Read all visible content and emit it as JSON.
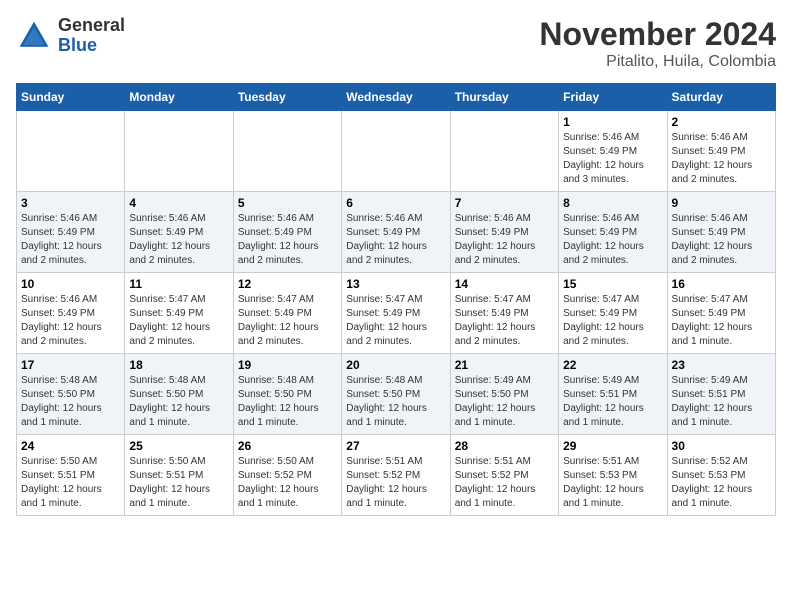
{
  "header": {
    "logo_general": "General",
    "logo_blue": "Blue",
    "month": "November 2024",
    "location": "Pitalito, Huila, Colombia"
  },
  "weekdays": [
    "Sunday",
    "Monday",
    "Tuesday",
    "Wednesday",
    "Thursday",
    "Friday",
    "Saturday"
  ],
  "weeks": [
    [
      {
        "day": "",
        "detail": ""
      },
      {
        "day": "",
        "detail": ""
      },
      {
        "day": "",
        "detail": ""
      },
      {
        "day": "",
        "detail": ""
      },
      {
        "day": "",
        "detail": ""
      },
      {
        "day": "1",
        "detail": "Sunrise: 5:46 AM\nSunset: 5:49 PM\nDaylight: 12 hours and 3 minutes."
      },
      {
        "day": "2",
        "detail": "Sunrise: 5:46 AM\nSunset: 5:49 PM\nDaylight: 12 hours and 2 minutes."
      }
    ],
    [
      {
        "day": "3",
        "detail": "Sunrise: 5:46 AM\nSunset: 5:49 PM\nDaylight: 12 hours and 2 minutes."
      },
      {
        "day": "4",
        "detail": "Sunrise: 5:46 AM\nSunset: 5:49 PM\nDaylight: 12 hours and 2 minutes."
      },
      {
        "day": "5",
        "detail": "Sunrise: 5:46 AM\nSunset: 5:49 PM\nDaylight: 12 hours and 2 minutes."
      },
      {
        "day": "6",
        "detail": "Sunrise: 5:46 AM\nSunset: 5:49 PM\nDaylight: 12 hours and 2 minutes."
      },
      {
        "day": "7",
        "detail": "Sunrise: 5:46 AM\nSunset: 5:49 PM\nDaylight: 12 hours and 2 minutes."
      },
      {
        "day": "8",
        "detail": "Sunrise: 5:46 AM\nSunset: 5:49 PM\nDaylight: 12 hours and 2 minutes."
      },
      {
        "day": "9",
        "detail": "Sunrise: 5:46 AM\nSunset: 5:49 PM\nDaylight: 12 hours and 2 minutes."
      }
    ],
    [
      {
        "day": "10",
        "detail": "Sunrise: 5:46 AM\nSunset: 5:49 PM\nDaylight: 12 hours and 2 minutes."
      },
      {
        "day": "11",
        "detail": "Sunrise: 5:47 AM\nSunset: 5:49 PM\nDaylight: 12 hours and 2 minutes."
      },
      {
        "day": "12",
        "detail": "Sunrise: 5:47 AM\nSunset: 5:49 PM\nDaylight: 12 hours and 2 minutes."
      },
      {
        "day": "13",
        "detail": "Sunrise: 5:47 AM\nSunset: 5:49 PM\nDaylight: 12 hours and 2 minutes."
      },
      {
        "day": "14",
        "detail": "Sunrise: 5:47 AM\nSunset: 5:49 PM\nDaylight: 12 hours and 2 minutes."
      },
      {
        "day": "15",
        "detail": "Sunrise: 5:47 AM\nSunset: 5:49 PM\nDaylight: 12 hours and 2 minutes."
      },
      {
        "day": "16",
        "detail": "Sunrise: 5:47 AM\nSunset: 5:49 PM\nDaylight: 12 hours and 1 minute."
      }
    ],
    [
      {
        "day": "17",
        "detail": "Sunrise: 5:48 AM\nSunset: 5:50 PM\nDaylight: 12 hours and 1 minute."
      },
      {
        "day": "18",
        "detail": "Sunrise: 5:48 AM\nSunset: 5:50 PM\nDaylight: 12 hours and 1 minute."
      },
      {
        "day": "19",
        "detail": "Sunrise: 5:48 AM\nSunset: 5:50 PM\nDaylight: 12 hours and 1 minute."
      },
      {
        "day": "20",
        "detail": "Sunrise: 5:48 AM\nSunset: 5:50 PM\nDaylight: 12 hours and 1 minute."
      },
      {
        "day": "21",
        "detail": "Sunrise: 5:49 AM\nSunset: 5:50 PM\nDaylight: 12 hours and 1 minute."
      },
      {
        "day": "22",
        "detail": "Sunrise: 5:49 AM\nSunset: 5:51 PM\nDaylight: 12 hours and 1 minute."
      },
      {
        "day": "23",
        "detail": "Sunrise: 5:49 AM\nSunset: 5:51 PM\nDaylight: 12 hours and 1 minute."
      }
    ],
    [
      {
        "day": "24",
        "detail": "Sunrise: 5:50 AM\nSunset: 5:51 PM\nDaylight: 12 hours and 1 minute."
      },
      {
        "day": "25",
        "detail": "Sunrise: 5:50 AM\nSunset: 5:51 PM\nDaylight: 12 hours and 1 minute."
      },
      {
        "day": "26",
        "detail": "Sunrise: 5:50 AM\nSunset: 5:52 PM\nDaylight: 12 hours and 1 minute."
      },
      {
        "day": "27",
        "detail": "Sunrise: 5:51 AM\nSunset: 5:52 PM\nDaylight: 12 hours and 1 minute."
      },
      {
        "day": "28",
        "detail": "Sunrise: 5:51 AM\nSunset: 5:52 PM\nDaylight: 12 hours and 1 minute."
      },
      {
        "day": "29",
        "detail": "Sunrise: 5:51 AM\nSunset: 5:53 PM\nDaylight: 12 hours and 1 minute."
      },
      {
        "day": "30",
        "detail": "Sunrise: 5:52 AM\nSunset: 5:53 PM\nDaylight: 12 hours and 1 minute."
      }
    ]
  ]
}
